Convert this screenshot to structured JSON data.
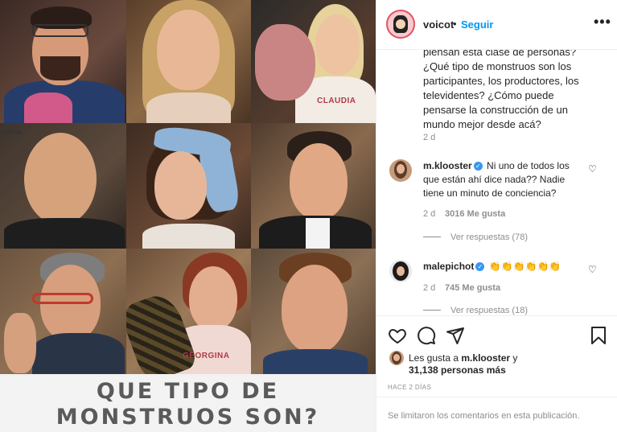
{
  "meme": {
    "line1": "QUE TIPO DE",
    "line2": "MONSTRUOS SON?",
    "cell_caption": "entina",
    "apron_claudia": "CLAUDIA",
    "apron_georgina": "GEORGINA"
  },
  "header": {
    "username": "voicot",
    "separator": "•",
    "follow_label": "Seguir",
    "more_label": "•••"
  },
  "caption": {
    "text": "piensan esta clase de personas? ¿Qué tipo de monstruos son los participantes, los productores, los televidentes? ¿Cómo puede pensarse la construcción de un mundo mejor desde acá?",
    "age": "2 d"
  },
  "comments": [
    {
      "username": "m.klooster",
      "text": "Ni uno de todos los que están ahí dice nada?? Nadie tiene un minuto de conciencia?",
      "age": "2 d",
      "likes": "3016 Me gusta",
      "replies": "Ver respuestas (78)"
    },
    {
      "username": "malepichot",
      "text": "👏👏👏👏👏👏",
      "age": "2 d",
      "likes": "745 Me gusta",
      "replies": "Ver respuestas (18)"
    }
  ],
  "likes": {
    "prefix": "Les gusta a ",
    "user": "m.klooster",
    "suffix": " y",
    "count": "31,138 personas más"
  },
  "timestamp": "HACE 2 DÍAS",
  "footer": {
    "limited_comments": "Se limitaron los comentarios en esta publicación."
  },
  "colors": {
    "link": "#0095f6",
    "verified": "#3897f0",
    "muted": "#8e8e8e"
  }
}
